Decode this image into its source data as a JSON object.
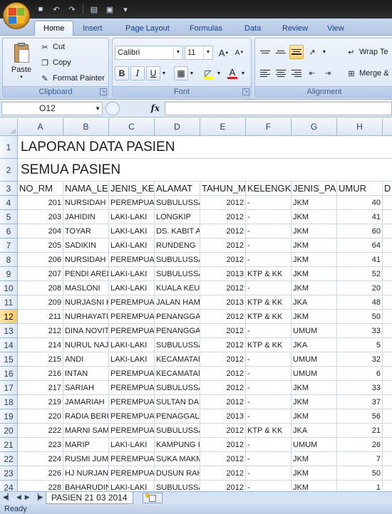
{
  "qat": {
    "save": "save-icon",
    "undo": "undo-icon",
    "redo": "redo-icon"
  },
  "tabs": [
    "Home",
    "Insert",
    "Page Layout",
    "Formulas",
    "Data",
    "Review",
    "View"
  ],
  "clipboard": {
    "paste": "Paste",
    "cut": "Cut",
    "copy": "Copy",
    "format_painter": "Format Painter",
    "label": "Clipboard"
  },
  "font": {
    "name": "Calibri",
    "size": "11",
    "grow": "A",
    "shrink": "A",
    "bold": "B",
    "italic": "I",
    "underline": "U",
    "color_letter": "A",
    "label": "Font"
  },
  "alignment": {
    "wrap_text": "Wrap Te",
    "merge": "Merge &",
    "label": "Alignment"
  },
  "formula_bar": {
    "name_box": "O12",
    "fx": "fx",
    "content": ""
  },
  "columns": [
    "A",
    "B",
    "C",
    "D",
    "E",
    "F",
    "G",
    "H"
  ],
  "sheet": {
    "title1": "LAPORAN DATA PASIEN",
    "title2": "SEMUA PASIEN",
    "headers": [
      "NO_RM",
      "NAMA_LE",
      "JENIS_KEL",
      "ALAMAT",
      "TAHUN_M",
      "KELENGKA",
      "JENIS_PAS",
      "UMUR",
      "D"
    ],
    "rows": [
      [
        "201",
        "NURSIDAH",
        "PEREMPUAI",
        "SUBULUSSA",
        "2012",
        "-",
        "JKM",
        "40"
      ],
      [
        "203",
        "JAHIDIN",
        "LAKI-LAKI",
        "LONGKIP",
        "2012",
        "-",
        "JKM",
        "41"
      ],
      [
        "204",
        "TOYAR",
        "LAKI-LAKI",
        "DS. KABIT A",
        "2012",
        "-",
        "JKM",
        "60"
      ],
      [
        "205",
        "SADIKIN",
        "LAKI-LAKI",
        "RUNDENG",
        "2012",
        "-",
        "JKM",
        "64"
      ],
      [
        "206",
        "NURSIDAH",
        "PEREMPUAI",
        "SUBULUSSA",
        "2012",
        "-",
        "JKM",
        "41"
      ],
      [
        "207",
        "PENDI ARED",
        "LAKI-LAKI",
        "SUBULUSSA",
        "2013",
        "KTP & KK",
        "JKM",
        "52"
      ],
      [
        "208",
        "MASLONI",
        "LAKI-LAKI",
        "KUALA KEUF",
        "2012",
        "-",
        "JKM",
        "20"
      ],
      [
        "209",
        "NURJASNI K",
        "PEREMPUAI",
        "JALAN HAM",
        "2013",
        "KTP & KK",
        "JKA",
        "48"
      ],
      [
        "211",
        "NURHAYATI",
        "PEREMPUAI",
        "PENANGGAI",
        "2012",
        "KTP & KK",
        "JKM",
        "50"
      ],
      [
        "212",
        "DINA NOVIT",
        "PEREMPUAI",
        "PENANGGAI",
        "2012",
        "-",
        "UMUM",
        "33"
      ],
      [
        "214",
        "NURUL NAJI",
        "LAKI-LAKI",
        "SUBULUSSA",
        "2012",
        "KTP & KK",
        "JKA",
        "5"
      ],
      [
        "215",
        "ANDI",
        "LAKI-LAKI",
        "KECAMATAN",
        "2012",
        "-",
        "UMUM",
        "32"
      ],
      [
        "216",
        "INTAN",
        "PEREMPUAI",
        "KECAMATAN",
        "2012",
        "-",
        "UMUM",
        "6"
      ],
      [
        "217",
        "SARIAH",
        "PEREMPUAI",
        "SUBULUSSA",
        "2012",
        "-",
        "JKM",
        "33"
      ],
      [
        "219",
        "JAMARIAH",
        "PEREMPUAI",
        "SULTAN DAU",
        "2012",
        "-",
        "JKM",
        "37"
      ],
      [
        "220",
        "RADIA BERU",
        "PEREMPUAI",
        "PENAGGALA",
        "2013",
        "-",
        "JKM",
        "56"
      ],
      [
        "222",
        "MARNI SAM",
        "PEREMPUAI",
        "SUBULUSSA",
        "2012",
        "KTP & KK",
        "JKA",
        "21"
      ],
      [
        "223",
        "MARIP",
        "LAKI-LAKI",
        "KAMPUNG I",
        "2012",
        "-",
        "UMUM",
        "26"
      ],
      [
        "224",
        "RUSMI JUM",
        "PEREMPUAI",
        "SUKA MAKM",
        "2012",
        "-",
        "JKM",
        "7"
      ],
      [
        "226",
        "HJ NURJANN",
        "PEREMPUAI",
        "DUSUN RAH",
        "2012",
        "-",
        "JKM",
        "50"
      ],
      [
        "228",
        "BAHARUDIN",
        "LAKI-LAKI",
        "SUBULUSSA",
        "2012",
        "-",
        "JKM",
        "1"
      ]
    ]
  },
  "row_numbers": [
    "1",
    "2",
    "3",
    "4",
    "5",
    "6",
    "7",
    "8",
    "9",
    "10",
    "11",
    "12",
    "13",
    "14",
    "15",
    "16",
    "17",
    "18",
    "19",
    "20",
    "21",
    "22",
    "23",
    "24"
  ],
  "selected_row": "12",
  "sheet_tab": "PASIEN 21 03 2014",
  "status": "Ready"
}
